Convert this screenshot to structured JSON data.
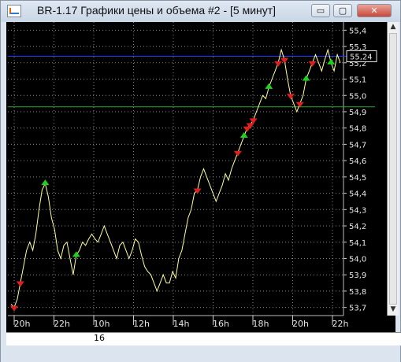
{
  "window": {
    "title": "BR-1.17 Графики цены и объема #2 - [5 минут]",
    "minimize_label": "▭",
    "restore_label": "▢",
    "close_label": "✕"
  },
  "chart_data": {
    "type": "line",
    "price_axis": {
      "ticks": [
        "55,4",
        "55,3",
        "55,2",
        "55,1",
        "55,0",
        "54,9",
        "54,8",
        "54,7",
        "54,6",
        "54,5",
        "54,4",
        "54,3",
        "54,2",
        "54,1",
        "54,0",
        "53,9",
        "53,8",
        "53,7"
      ],
      "range": [
        53.65,
        55.45
      ]
    },
    "time_axis": {
      "ticks": [
        "20h",
        "22h",
        "10h",
        "12h",
        "14h",
        "16h",
        "18h",
        "20h",
        "22h"
      ],
      "date_label": "16"
    },
    "current_price": "55,24",
    "horizontal_lines": [
      {
        "value": 55.24,
        "color": "#1e3cff"
      },
      {
        "value": 54.93,
        "color": "#2aa82a"
      }
    ],
    "series": [
      {
        "color": "#ffff99",
        "values": [
          53.72,
          53.7,
          53.75,
          53.85,
          53.95,
          54.05,
          54.1,
          54.05,
          54.15,
          54.3,
          54.42,
          54.46,
          54.38,
          54.25,
          54.18,
          54.05,
          54.0,
          54.08,
          54.1,
          54.0,
          53.9,
          54.02,
          54.05,
          54.1,
          54.08,
          54.12,
          54.15,
          54.12,
          54.1,
          54.15,
          54.2,
          54.15,
          54.1,
          54.05,
          54.0,
          54.08,
          54.1,
          54.05,
          54.0,
          54.05,
          54.12,
          54.1,
          54.02,
          53.95,
          53.92,
          53.9,
          53.85,
          53.8,
          53.85,
          53.9,
          53.85,
          53.85,
          53.92,
          53.88,
          54.0,
          54.05,
          54.15,
          54.25,
          54.3,
          54.4,
          54.42,
          54.5,
          54.55,
          54.5,
          54.45,
          54.4,
          54.35,
          54.4,
          54.45,
          54.52,
          54.48,
          54.55,
          54.6,
          54.65,
          54.7,
          54.75,
          54.8,
          54.82,
          54.85,
          54.9,
          54.95,
          55.0,
          54.98,
          55.05,
          55.1,
          55.15,
          55.2,
          55.28,
          55.22,
          55.1,
          55.0,
          54.95,
          54.9,
          54.95,
          55.0,
          55.1,
          55.15,
          55.2,
          55.25,
          55.2,
          55.15,
          55.22,
          55.28,
          55.2,
          55.15,
          55.25,
          55.2
        ]
      }
    ],
    "buy_signals": [
      11,
      21,
      75,
      83,
      95,
      103
    ],
    "sell_signals": [
      1,
      3,
      60,
      73,
      76,
      77,
      78,
      86,
      88,
      90,
      93,
      97
    ]
  }
}
